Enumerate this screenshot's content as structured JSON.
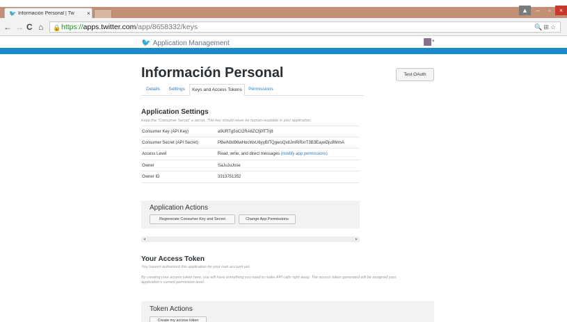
{
  "browser": {
    "tab_title": "Información Personal | Tw",
    "tab_close": "×",
    "url_scheme": "https://",
    "url_host": "apps.twitter.com",
    "url_path": "/app/8658332/keys",
    "window_controls": {
      "minimize": "–",
      "maximize": "▫",
      "close": "×"
    }
  },
  "header": {
    "brand": "Application Management"
  },
  "page": {
    "title": "Información Personal",
    "test_oauth": "Test OAuth",
    "tabs": [
      {
        "label": "Details"
      },
      {
        "label": "Settings"
      },
      {
        "label": "Keys and Access Tokens",
        "active": true
      },
      {
        "label": "Permissions"
      }
    ]
  },
  "application_settings": {
    "title": "Application Settings",
    "note": "Keep the \"Consumer Secret\" a secret. This key should never be human-readable in your application.",
    "rows": [
      {
        "key": "Consumer Key (API Key)",
        "value": "a9URTg5oCt2RA6ZCfj0fT7rj8"
      },
      {
        "key": "Consumer Secret (API Secret)",
        "value": "PBeiN3d96wHocWxU6yyBITQgwoQx8JmRiRxrT3B3EayeDju9WmA"
      },
      {
        "key": "Access Level",
        "value": "Read, write, and direct messages",
        "link": "(modify app permissions)"
      },
      {
        "key": "Owner",
        "value": "SaJuJuJose"
      },
      {
        "key": "Owner ID",
        "value": "3313751352"
      }
    ]
  },
  "application_actions": {
    "title": "Application Actions",
    "regenerate": "Regenerate Consumer Key and Secret",
    "change_permissions": "Change App Permissions"
  },
  "access_token": {
    "title": "Your Access Token",
    "note1": "You haven't authorized this application for your own account yet.",
    "note2": "By creating your access token here, you will have everything you need to make API calls right away. The access token generated will be assigned your",
    "note3": "application's current permission level."
  },
  "token_actions": {
    "title": "Token Actions",
    "create": "Create my access token"
  },
  "icons": [
    "twitter-bird-icon",
    "lock-icon",
    "back-icon",
    "forward-icon",
    "reload-icon",
    "home-icon",
    "zoom-icon",
    "translate-icon",
    "star-icon",
    "user-icon"
  ],
  "colors": {
    "brand_blue": "#1a8ac9",
    "twitter_blue": "#55acee",
    "link": "#2b7bb9",
    "chrome_tab_strip": "#c29075"
  }
}
